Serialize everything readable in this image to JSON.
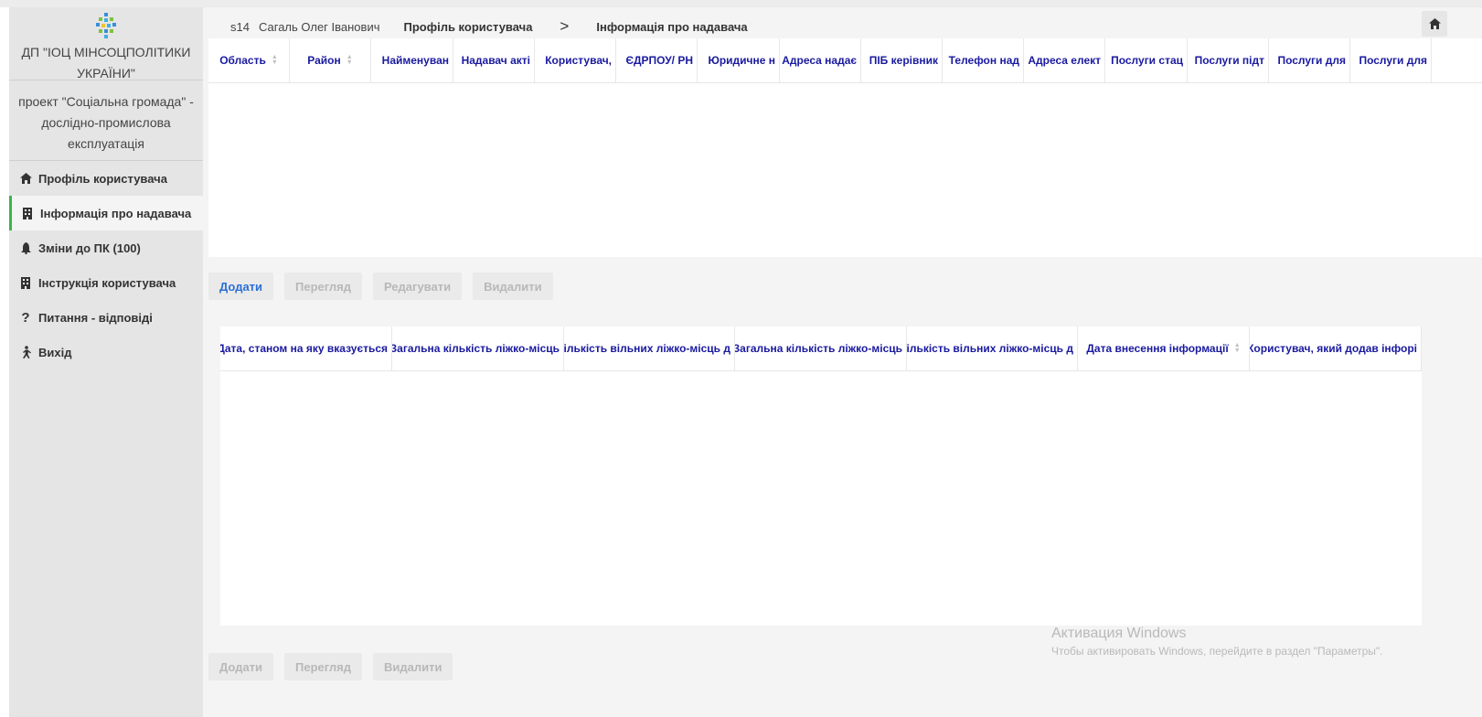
{
  "sidebar": {
    "org_line1": "ДП \"ІОЦ МІНСОЦПОЛІТИКИ",
    "org_line2": "УКРАЇНИ\"",
    "project_line1": "проект \"Соціальна громада\" -",
    "project_line2": "дослідно-промислова",
    "project_line3": "експлуатація",
    "items": [
      {
        "label": "Профіль користувача",
        "icon": "home-icon"
      },
      {
        "label": "Інформація про надавача",
        "icon": "building-icon"
      },
      {
        "label": "Зміни до ПК (100)",
        "icon": "bell-icon"
      },
      {
        "label": "Інструкція користувача",
        "icon": "building-icon"
      },
      {
        "label": "Питання - відповіді",
        "icon": "question-icon"
      },
      {
        "label": "Вихід",
        "icon": "walking-icon"
      }
    ]
  },
  "header": {
    "user_id": "s14",
    "user_name": "Сагаль Олег Іванович",
    "breadcrumb_profile": "Профіль користувача",
    "breadcrumb_separator": ">",
    "breadcrumb_current": "Інформація про надавача",
    "home_icon": "home-icon"
  },
  "table1": {
    "columns": [
      "Область",
      "Район",
      "Найменуван",
      "Надавач акті",
      "Користувач,",
      "ЄДРПОУ/ РН",
      "Юридичне н",
      "Адреса надає",
      "ПІБ керівник",
      "Телефон над",
      "Адреса елект",
      "Послуги стац",
      "Послуги підт",
      "Послуги для",
      "Послуги для"
    ]
  },
  "buttons1": {
    "add": "Додати",
    "view": "Перегляд",
    "edit": "Редагувати",
    "delete": "Видалити"
  },
  "table2": {
    "columns": [
      "Дата, станом на яку вказується",
      "Загальна кількість ліжко-місць",
      "Кількість вільних ліжко-місць д",
      "Загальна кількість ліжко-місць",
      "Кількість вільних ліжко-місць д",
      "Дата внесення інформації",
      "Користувач, який додав інфорі"
    ]
  },
  "buttons2": {
    "add": "Додати",
    "view": "Перегляд",
    "delete": "Видалити"
  },
  "watermark": {
    "title": "Активация Windows",
    "text": "Чтобы активировать Windows, перейдите в раздел \"Параметры\"."
  },
  "colors": {
    "accent": "#2b6fd6",
    "header_text": "#1a1aa0",
    "active_bar": "#3bb54a",
    "sidebar_bg": "#e5e5e5"
  }
}
